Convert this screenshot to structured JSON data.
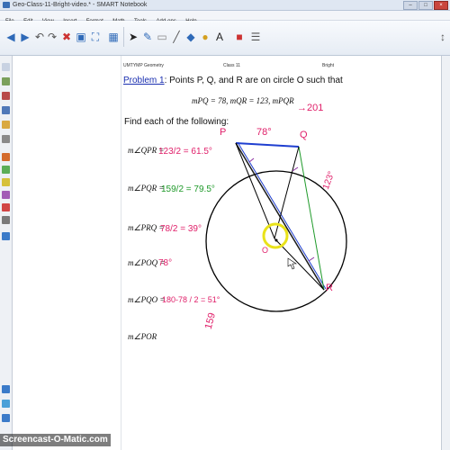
{
  "window": {
    "title": "Geo-Class-11-Bright-video.* - SMART Notebook"
  },
  "menu": [
    "File",
    "Edit",
    "View",
    "Insert",
    "Format",
    "Math",
    "Tools",
    "Add-ons",
    "Help"
  ],
  "page_header": {
    "left": "UMTYMP Geometry",
    "center": "Class 11",
    "right": "Bright"
  },
  "problem": {
    "label": "Problem 1",
    "text": ": Points P, Q, and R are on circle O such that",
    "given": "mPQ = 78, mQR = 123, mPQR",
    "find": "Find each of the following:"
  },
  "questions": [
    {
      "prompt": "m∠QPR =",
      "work": "123/2 = 61.5°"
    },
    {
      "prompt": "m∠PQR =",
      "work": "159/2 = 79.5°"
    },
    {
      "prompt": "m∠PRQ =",
      "work": "78/2 = 39°"
    },
    {
      "prompt": "m∠POQ =",
      "work": "78°"
    },
    {
      "prompt": "m∠PQO =",
      "work": "180-78 / 2 = 51°"
    },
    {
      "prompt": "m∠POR",
      "work": ""
    }
  ],
  "annotations": {
    "given_arrow": "→201",
    "arc_pq": "78°",
    "arc_qr": "123°",
    "arc_pr": "159"
  },
  "diagram_labels": {
    "p": "P",
    "q": "Q",
    "r": "R",
    "o": "O"
  },
  "watermark": "Screencast-O-Matic.com",
  "colors": {
    "problem_label": "#1a2fb0",
    "ink_pink": "#e0206a",
    "ink_blue": "#1f3fd0",
    "ink_green": "#1f9a2a",
    "ink_purple": "#8a2fa0",
    "highlight": "#e9e21a"
  }
}
